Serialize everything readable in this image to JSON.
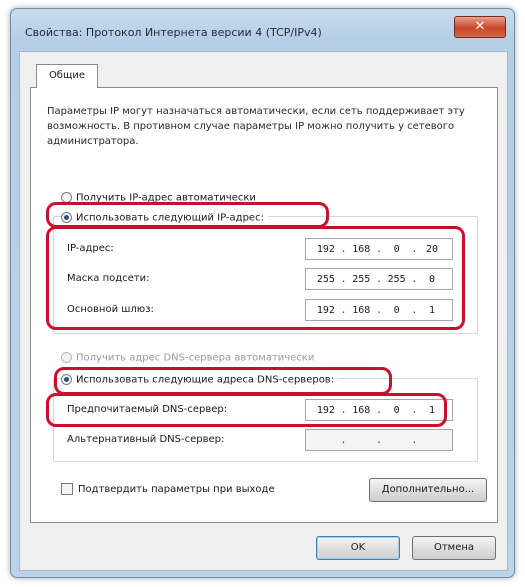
{
  "window": {
    "title": "Свойства: Протокол Интернета версии 4 (TCP/IPv4)",
    "close_glyph": "✕"
  },
  "tabs": [
    {
      "label": "Общие"
    }
  ],
  "description": "Параметры IP могут назначаться автоматически, если сеть поддерживает эту возможность. В противном случае параметры IP можно получить у сетевого администратора.",
  "ip_section": {
    "auto_label": "Получить IP-адрес автоматически",
    "manual_label": "Использовать следующий IP-адрес:",
    "selected": "manual",
    "fields": [
      {
        "label": "IP-адрес:",
        "octets": [
          "192",
          "168",
          "0",
          "20"
        ]
      },
      {
        "label": "Маска подсети:",
        "octets": [
          "255",
          "255",
          "255",
          "0"
        ]
      },
      {
        "label": "Основной шлюз:",
        "octets": [
          "192",
          "168",
          "0",
          "1"
        ]
      }
    ]
  },
  "dns_section": {
    "auto_label": "Получить адрес DNS-сервера автоматически",
    "manual_label": "Использовать следующие адреса DNS-серверов:",
    "selected": "manual",
    "fields": [
      {
        "label": "Предпочитаемый DNS-сервер:",
        "octets": [
          "192",
          "168",
          "0",
          "1"
        ]
      },
      {
        "label": "Альтернативный DNS-сервер:",
        "octets": [
          "",
          "",
          "",
          ""
        ]
      }
    ]
  },
  "validate_label": "Подтвердить параметры при выходе",
  "buttons": {
    "advanced": "Дополнительно...",
    "ok": "OK",
    "cancel": "Отмена"
  },
  "colors": {
    "highlight": "#c8102e",
    "title_bar": "#b6cfe6"
  },
  "icons": [
    "close-icon",
    "radio-icon",
    "checkbox-icon"
  ]
}
